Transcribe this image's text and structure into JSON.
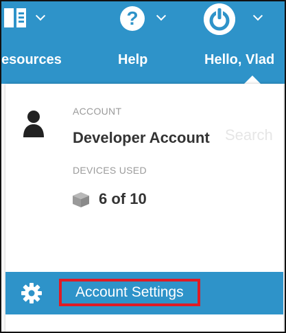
{
  "nav": {
    "resources_label": "esources",
    "help_label": "Help",
    "user_label": "Hello, Vlad",
    "help_glyph": "?",
    "icons": [
      "book-icon",
      "help-icon",
      "power-icon"
    ]
  },
  "menu": {
    "account_label": "ACCOUNT",
    "account_value": "Developer Account",
    "devices_label": "DEVICES USED",
    "devices_value": "6 of 10",
    "ghost_text": "Search",
    "settings_label": "Account Settings",
    "icons": [
      "user-icon",
      "box-icon",
      "gear-icon"
    ]
  },
  "colors": {
    "brand_blue": "#2e93c9",
    "highlight_red": "#e01b24"
  }
}
